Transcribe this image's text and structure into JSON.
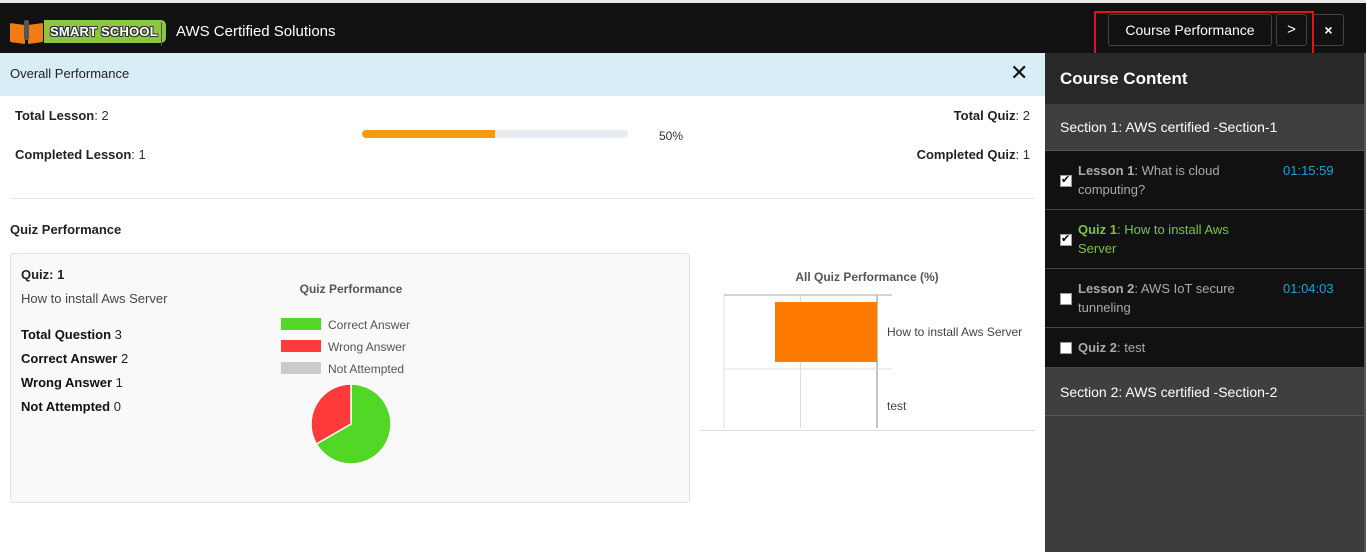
{
  "header": {
    "logo_text": "SMART SCHOOL",
    "course_title": "AWS Certified Solutions",
    "course_performance_label": "Course Performance",
    "next_label": ">",
    "close_label": "×"
  },
  "overall": {
    "title": "Overall Performance",
    "close_label": "✕",
    "total_lesson_label": "Total Lesson",
    "total_lesson_value": ": 2",
    "completed_lesson_label": "Completed Lesson",
    "completed_lesson_value": ": 1",
    "total_quiz_label": "Total Quiz",
    "total_quiz_value": ": 2",
    "completed_quiz_label": "Completed Quiz",
    "completed_quiz_value": ": 1",
    "progress_percent": 50,
    "progress_label": "50%",
    "progress_color": "#f39c12"
  },
  "quiz_performance": {
    "title": "Quiz Performance",
    "quiz_label": "Quiz: 1",
    "quiz_name": "How to install Aws Server",
    "total_question_label": "Total Question",
    "total_question_value": " 3",
    "correct_label": "Correct Answer",
    "correct_value": " 2",
    "wrong_label": "Wrong Answer",
    "wrong_value": " 1",
    "not_attempted_label": "Not Attempted",
    "not_attempted_value": " 0"
  },
  "chart_data": [
    {
      "type": "pie",
      "title": "Quiz Performance",
      "legend_position": "top",
      "labels": [
        "Correct Answer",
        "Wrong Answer",
        "Not Attempted"
      ],
      "values": [
        2,
        1,
        0
      ],
      "colors": [
        "#52d726",
        "#ff3a3a",
        "#c9cacd"
      ]
    },
    {
      "type": "bar",
      "orientation": "horizontal-reversed",
      "title": "All Quiz Performance (%)",
      "categories": [
        "How to install Aws Server",
        "test"
      ],
      "values": [
        66.67,
        0
      ],
      "xlim": [
        0,
        100
      ],
      "xticks": [
        "100",
        "50",
        "0"
      ],
      "grid": true,
      "color": "#ff7b00"
    }
  ],
  "sidebar": {
    "title": "Course Content",
    "sections": [
      {
        "title": "Section 1: AWS certified -Section-1",
        "items": [
          {
            "prefix": "Lesson 1",
            "text": ": What is cloud computing?",
            "duration": "01:15:59",
            "checked": true,
            "active": false
          },
          {
            "prefix": "Quiz 1",
            "text": ": How to install Aws Server",
            "duration": "",
            "checked": true,
            "active": true
          },
          {
            "prefix": "Lesson 2",
            "text": ": AWS IoT secure tunneling",
            "duration": "01:04:03",
            "checked": false,
            "active": false
          },
          {
            "prefix": "Quiz 2",
            "text": ": test",
            "duration": "",
            "checked": false,
            "active": false
          }
        ]
      },
      {
        "title": "Section 2: AWS certified -Section-2",
        "items": []
      }
    ]
  }
}
